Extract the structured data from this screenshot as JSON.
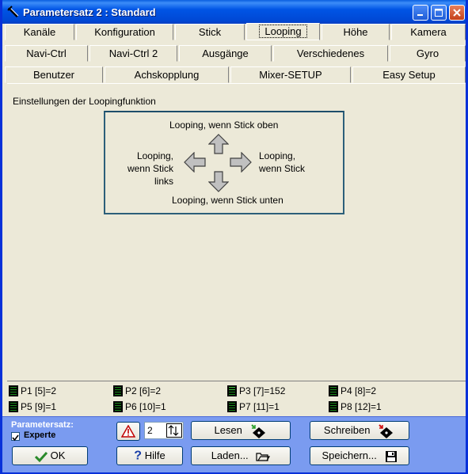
{
  "window": {
    "title": "Parametersatz 2 : Standard"
  },
  "tabs": {
    "row1": [
      "Kanäle",
      "Konfiguration",
      "Stick",
      "Looping",
      "Höhe",
      "Kamera"
    ],
    "row2": [
      "Navi-Ctrl",
      "Navi-Ctrl 2",
      "Ausgänge",
      "Verschiedenes",
      "Gyro"
    ],
    "row3": [
      "Benutzer",
      "Achskopplung",
      "Mixer-SETUP",
      "Easy Setup"
    ],
    "active": "Looping"
  },
  "looping": {
    "heading": "Einstellungen der Loopingfunktion",
    "up_label": "Looping, wenn Stick oben",
    "left_label_1": "Looping,",
    "left_label_2": "wenn Stick",
    "left_label_3": "links",
    "right_label_1": "Looping,",
    "right_label_2": "wenn Stick",
    "down_label": "Looping, wenn Stick unten"
  },
  "status": {
    "p1": "P1 [5]=2",
    "p2": "P2 [6]=2",
    "p3": "P3 [7]=152",
    "p4": "P4 [8]=2",
    "p5": "P5 [9]=1",
    "p6": "P6 [10]=1",
    "p7": "P7 [11]=1",
    "p8": "P8 [12]=1"
  },
  "footer": {
    "paramset_label": "Parametersatz:",
    "expert_label": "Experte",
    "expert_checked": true,
    "paramset_value": "2",
    "ok": "OK",
    "help": "Hilfe",
    "read": "Lesen",
    "load": "Laden...",
    "write": "Schreiben",
    "save": "Speichern..."
  },
  "colors": {
    "titlebar": "#0055e5",
    "footer": "#7a9bf0",
    "panel_border": "#2c5f7a"
  }
}
